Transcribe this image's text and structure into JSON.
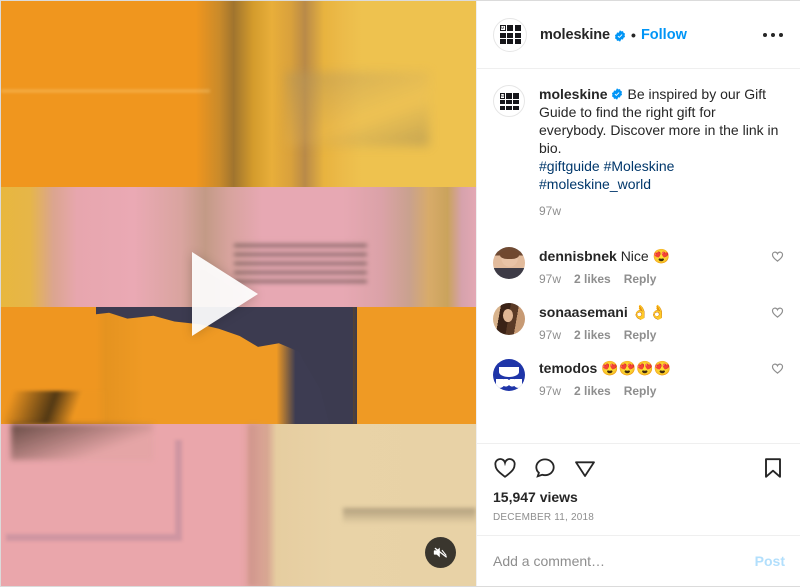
{
  "header": {
    "username": "moleskine",
    "verified_icon": "verified-badge-icon",
    "separator": "•",
    "follow_label": "Follow",
    "more_icon": "more-options-icon"
  },
  "media": {
    "play_icon": "play-button-icon",
    "mute_icon": "mute-audio-icon",
    "type": "video"
  },
  "caption": {
    "username": "moleskine",
    "text": "Be inspired by our Gift Guide to find the right gift for everybody. Discover more in the link in bio.",
    "hashtags": "#giftguide #Moleskine #moleskine_world",
    "time": "97w"
  },
  "comments": [
    {
      "username": "dennisbnek",
      "text": "Nice 😍",
      "time": "97w",
      "likes": "2 likes",
      "reply": "Reply",
      "avatar": "av-dennis",
      "like_icon": "heart-outline-icon"
    },
    {
      "username": "sonaasemani",
      "text": "👌👌",
      "time": "97w",
      "likes": "2 likes",
      "reply": "Reply",
      "avatar": "av-sona",
      "like_icon": "heart-outline-icon"
    },
    {
      "username": "temodos",
      "text": "😍😍😍😍",
      "time": "97w",
      "likes": "2 likes",
      "reply": "Reply",
      "avatar": "av-temodos",
      "like_icon": "heart-outline-icon"
    }
  ],
  "actions": {
    "like_icon": "heart-outline-icon",
    "comment_icon": "comment-bubble-icon",
    "share_icon": "share-paper-plane-icon",
    "save_icon": "bookmark-outline-icon",
    "views": "15,947 views",
    "date": "DECEMBER 11, 2018"
  },
  "add_comment": {
    "placeholder": "Add a comment…",
    "value": "",
    "post_label": "Post"
  },
  "colors": {
    "accent_blue": "#0095f6",
    "link_blue": "#00376b",
    "post_disabled": "#b2dffc",
    "text_primary": "#262626",
    "text_secondary": "#8e8e8e",
    "divider": "#efefef"
  }
}
